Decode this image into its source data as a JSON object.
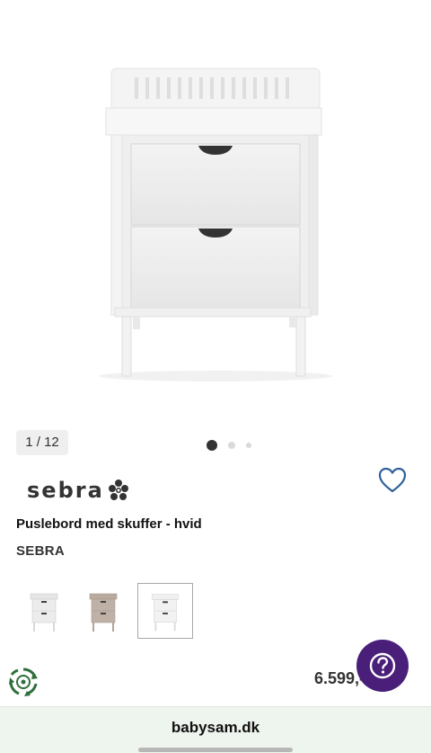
{
  "gallery": {
    "counter": "1 / 12",
    "dots_count": 3,
    "active_dot": 0
  },
  "brand_logo": {
    "text": "sebra"
  },
  "product": {
    "title": "Puslebord med skuffer - hvid",
    "brand": "SEBRA",
    "price": "6.599,- kr."
  },
  "thumbnails": [
    {
      "variant": "white",
      "color": "#e9e9e9",
      "selected": false
    },
    {
      "variant": "taupe",
      "color": "#bfb1a6",
      "selected": false
    },
    {
      "variant": "white",
      "color": "#efefef",
      "selected": true
    }
  ],
  "browser": {
    "url": "babysam.dk"
  },
  "colors": {
    "accent": "#4a1f7a",
    "heart": "#2f5f9a",
    "url_bar": "#eef4ee",
    "recycle": "#2f6f3b"
  },
  "icons": [
    "heart-icon",
    "question-icon",
    "recycle-icon"
  ]
}
